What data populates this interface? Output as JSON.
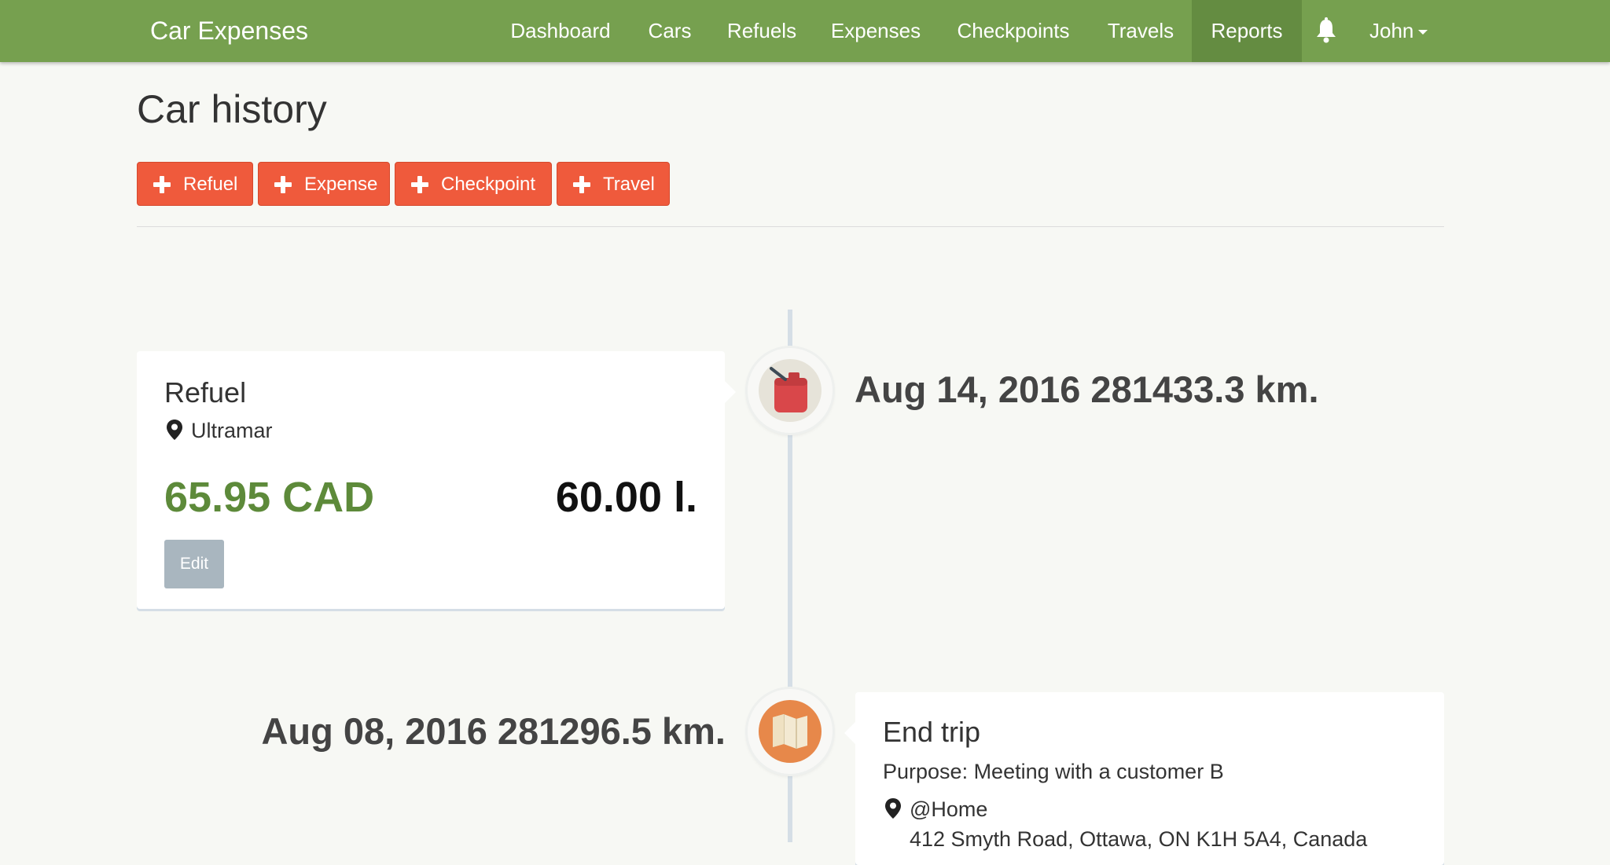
{
  "navbar": {
    "brand": "Car Expenses",
    "items": [
      {
        "label": "Dashboard"
      },
      {
        "label": "Cars"
      },
      {
        "label": "Refuels"
      },
      {
        "label": "Expenses"
      },
      {
        "label": "Checkpoints"
      },
      {
        "label": "Travels"
      },
      {
        "label": "Reports",
        "active": true
      }
    ],
    "notification_icon": "bell-icon",
    "user": "John"
  },
  "page": {
    "title": "Car history",
    "actions": [
      {
        "label": "Refuel",
        "icon": "plus-icon"
      },
      {
        "label": "Expense",
        "icon": "plus-icon"
      },
      {
        "label": "Checkpoint",
        "icon": "plus-icon"
      },
      {
        "label": "Travel",
        "icon": "plus-icon"
      }
    ]
  },
  "timeline": [
    {
      "type": "Refuel",
      "icon": "fuel-can-icon",
      "date": "Aug 14, 2016 281433.3 km.",
      "location": "Ultramar",
      "amount": "65.95 CAD",
      "volume": "60.00 l.",
      "edit_label": "Edit"
    },
    {
      "type": "End trip",
      "icon": "map-icon",
      "date": "Aug 08, 2016 281296.5 km.",
      "purpose": "Purpose: Meeting with a customer B",
      "location": "@Home",
      "address": "412 Smyth Road, Ottawa, ON K1H 5A4, Canada"
    }
  ],
  "colors": {
    "navbar": "#76a04f",
    "navbar_active": "#648c41",
    "action_button": "#ef5a3c",
    "amount": "#5d8a3a",
    "background": "#f7f8f4"
  }
}
